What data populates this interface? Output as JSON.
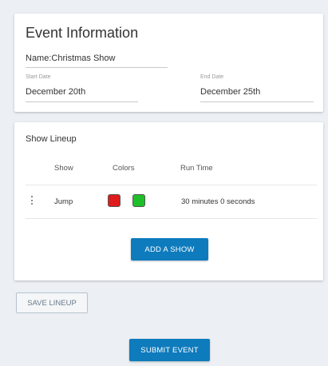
{
  "event_info": {
    "title": "Event Information",
    "name_label": "Name:",
    "name_value": "Christmas Show",
    "start_label": "Start Date",
    "start_value": "December 20th",
    "end_label": "End Date",
    "end_value": "December 25th"
  },
  "lineup": {
    "title": "Show Lineup",
    "columns": {
      "show": "Show",
      "colors": "Colors",
      "run_time": "Run Time"
    },
    "rows": [
      {
        "show": "Jump",
        "colors": [
          "#e01b1b",
          "#1fbf2a"
        ],
        "run_time": "30 minutes 0 seconds"
      }
    ],
    "add_show_label": "ADD A SHOW"
  },
  "actions": {
    "save_lineup_label": "SAVE LINEUP",
    "submit_event_label": "SUBMIT EVENT"
  },
  "colors": {
    "primary_button": "#0e7bbd",
    "background": "#eceff3"
  }
}
